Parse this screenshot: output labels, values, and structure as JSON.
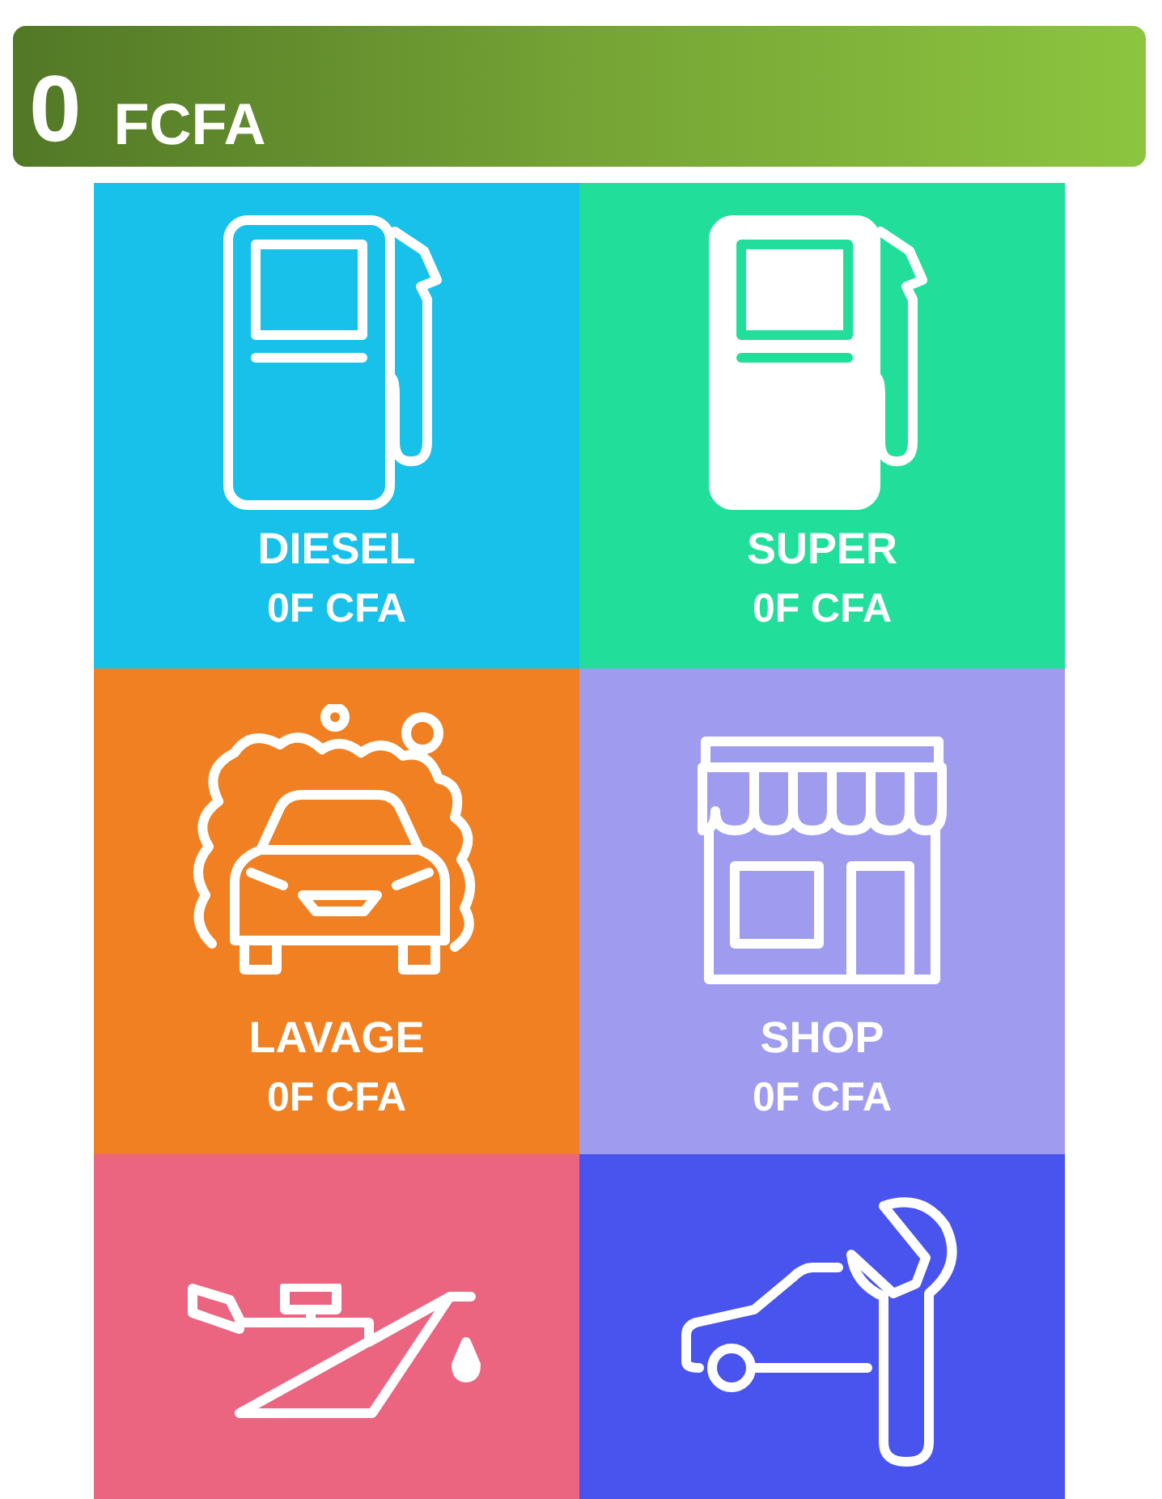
{
  "balance": {
    "amount": "0",
    "currency": "FCFA"
  },
  "tiles": [
    {
      "kind": "pump",
      "color": "#17c1ea",
      "label": "DIESEL",
      "amount": "0F CFA"
    },
    {
      "kind": "pump-filled",
      "color": "#21de9b",
      "label": "SUPER",
      "amount": "0F CFA"
    },
    {
      "kind": "carwash",
      "color": "#f08022",
      "label": "LAVAGE",
      "amount": "0F CFA"
    },
    {
      "kind": "shop",
      "color": "#9f9cf0",
      "label": "SHOP",
      "amount": "0F CFA"
    },
    {
      "kind": "oil",
      "color": "#eb6480"
    },
    {
      "kind": "service",
      "color": "#4953ee"
    }
  ]
}
